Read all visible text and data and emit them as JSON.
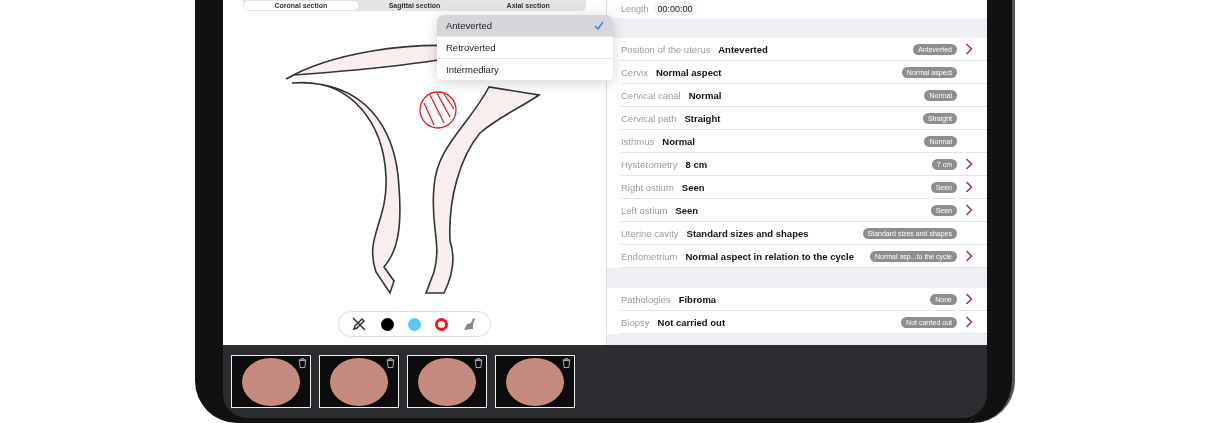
{
  "segments": [
    {
      "label": "Coronal section",
      "selected": true
    },
    {
      "label": "Sagittal section",
      "selected": false
    },
    {
      "label": "Axial section",
      "selected": false
    }
  ],
  "position_menu": {
    "options": [
      {
        "label": "Anteverted",
        "selected": true
      },
      {
        "label": "Retroverted",
        "selected": false
      },
      {
        "label": "Intermediary",
        "selected": false
      }
    ]
  },
  "toolbar": {
    "tools": [
      {
        "kind": "pen-off"
      },
      {
        "kind": "color",
        "color": "#000000",
        "selected": false
      },
      {
        "kind": "color",
        "color": "#5ac8fa",
        "selected": false
      },
      {
        "kind": "color",
        "color": "#ff1010",
        "selected": true
      },
      {
        "kind": "clear"
      }
    ]
  },
  "length": {
    "label": "Length",
    "value": "00:00:00"
  },
  "sections": [
    {
      "rows": [
        {
          "label": "Position of the uterus",
          "value": "Anteverted",
          "badge": "Anteverted",
          "chevron": true
        },
        {
          "label": "Cervix",
          "value": "Normal aspect",
          "badge": "Normal aspect",
          "chevron": false
        },
        {
          "label": "Cervical canal",
          "value": "Normal",
          "badge": "Normal",
          "chevron": false
        },
        {
          "label": "Cervical path",
          "value": "Straight",
          "badge": "Straight",
          "chevron": false
        },
        {
          "label": "Isthmus",
          "value": "Normal",
          "badge": "Normal",
          "chevron": false
        },
        {
          "label": "Hysterometry",
          "value": "8 cm",
          "badge": "7 cm",
          "chevron": true
        },
        {
          "label": "Right ostium",
          "value": "Seen",
          "badge": "Seen",
          "chevron": true
        },
        {
          "label": "Left ostium",
          "value": "Seen",
          "badge": "Seen",
          "chevron": true
        },
        {
          "label": "Uterine cavity",
          "value": "Standard sizes and shapes",
          "badge": "Standard sizes and shapes",
          "chevron": false
        },
        {
          "label": "Endometrium",
          "value": "Normal aspect in relation to the cycle",
          "badge": "Normal asp...to the cycle",
          "chevron": true
        }
      ]
    },
    {
      "rows": [
        {
          "label": "Pathologies",
          "value": "Fibroma",
          "badge": "None",
          "chevron": true
        },
        {
          "label": "Biopsy",
          "value": "Not carried out",
          "badge": "Not carried out",
          "chevron": true
        }
      ]
    }
  ],
  "thumbnails": [
    {
      "deletable": true
    },
    {
      "deletable": true
    },
    {
      "deletable": true
    },
    {
      "deletable": true
    }
  ]
}
